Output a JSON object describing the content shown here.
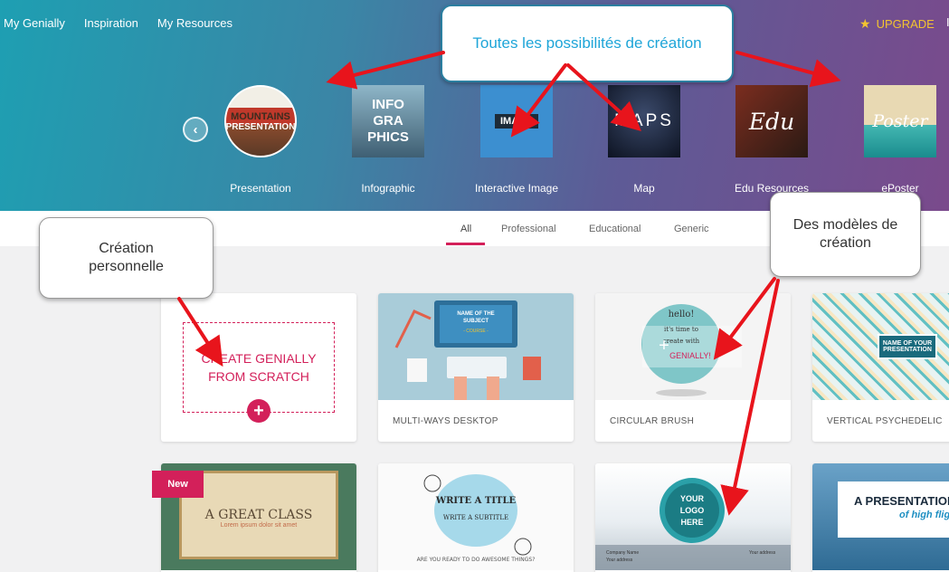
{
  "topnav": {
    "items": [
      "My Genially",
      "Inspiration",
      "My Resources"
    ]
  },
  "upgrade": {
    "label": "UPGRADE",
    "edge_letter": "I"
  },
  "categories": [
    {
      "label": "Presentation",
      "thumb_lines": [
        "MOUNTAINS",
        "PRESENTATION"
      ]
    },
    {
      "label": "Infographic",
      "thumb_lines": [
        "INFO",
        "GRA",
        "PHICS"
      ]
    },
    {
      "label": "Interactive Image",
      "thumb_lines": [
        "IMAGE"
      ]
    },
    {
      "label": "Map",
      "thumb_lines": [
        "MAPS"
      ]
    },
    {
      "label": "Edu Resources",
      "thumb_lines": [
        "Edu"
      ]
    },
    {
      "label": "ePoster",
      "thumb_lines": [
        "Poster"
      ]
    }
  ],
  "filters": {
    "tabs": [
      "All",
      "Professional",
      "Educational",
      "Generic"
    ],
    "active": "All"
  },
  "scratch": {
    "line1": "CREATE GENIALLY",
    "line2": "FROM SCRATCH"
  },
  "templates": [
    {
      "name": "MULTI-WAYS DESKTOP",
      "img_text": [
        "NAME OF THE",
        "SUBJECT",
        "- COURSE -"
      ]
    },
    {
      "name": "CIRCULAR BRUSH",
      "img_text": [
        "hello!",
        "it's time to",
        "create with",
        "GENIALLY!"
      ]
    },
    {
      "name": "VERTICAL PSYCHEDELIC",
      "img_text": [
        "NAME OF YOUR",
        "PRESENTATION"
      ]
    }
  ],
  "row2": [
    {
      "img_text": [
        "A GREAT CLASS",
        "Lorem ipsum dolor sit amet"
      ],
      "badge": "New"
    },
    {
      "img_text": [
        "WRITE A TITLE",
        "WRITE A SUBTITLE",
        "ARE YOU READY TO DO AWESOME THINGS?"
      ]
    },
    {
      "img_text": [
        "YOUR",
        "LOGO",
        "HERE",
        "Company Name",
        "Your address",
        "Your address"
      ]
    },
    {
      "img_text": [
        "A PRESENTATION",
        "of high flig"
      ]
    }
  ],
  "callouts": {
    "all": "Toutes les possibilités de création",
    "models": [
      "Des modèles de",
      "création"
    ],
    "personal": [
      "Création",
      "personnelle"
    ]
  },
  "colors": {
    "accent": "#d3205a",
    "callout_text_blue": "#1ea5d8",
    "arrow_red": "#e8141c",
    "upgrade_gold": "#f3c430"
  }
}
